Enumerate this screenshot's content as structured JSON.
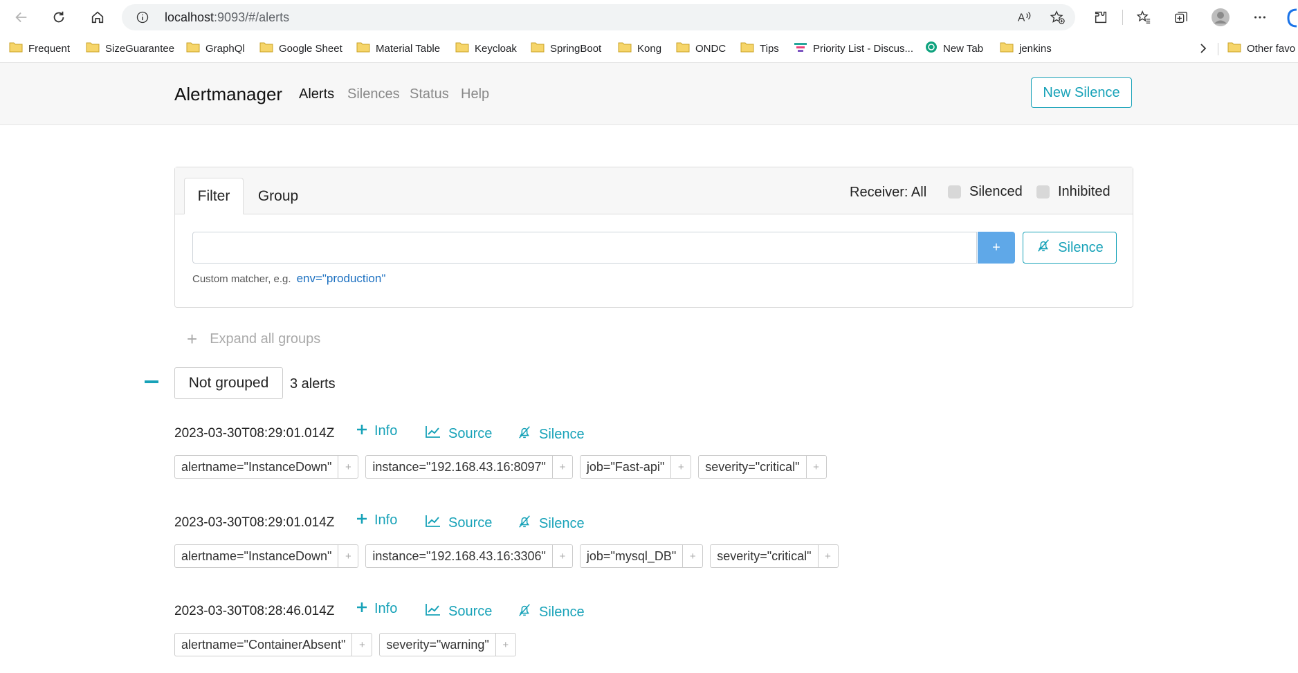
{
  "browser": {
    "url_host": "localhost",
    "url_path": ":9093/#/alerts",
    "bookmarks": [
      {
        "label": "Frequent",
        "icon": "folder-icon"
      },
      {
        "label": "SizeGuarantee",
        "icon": "folder-icon"
      },
      {
        "label": "GraphQl",
        "icon": "folder-icon"
      },
      {
        "label": "Google Sheet",
        "icon": "folder-icon"
      },
      {
        "label": "Material Table",
        "icon": "folder-icon"
      },
      {
        "label": "Keycloak",
        "icon": "folder-icon"
      },
      {
        "label": "SpringBoot",
        "icon": "folder-icon"
      },
      {
        "label": "Kong",
        "icon": "folder-icon"
      },
      {
        "label": "ONDC",
        "icon": "folder-icon"
      },
      {
        "label": "Tips",
        "icon": "folder-icon"
      },
      {
        "label": "Priority List - Discus...",
        "icon": "list-icon"
      },
      {
        "label": "New Tab",
        "icon": "openai-icon"
      },
      {
        "label": "jenkins",
        "icon": "folder-icon"
      }
    ],
    "other_favorites": "Other favo"
  },
  "navbar": {
    "brand": "Alertmanager",
    "links": [
      "Alerts",
      "Silences",
      "Status",
      "Help"
    ],
    "active": "Alerts",
    "new_silence": "New Silence"
  },
  "filter": {
    "tabs": [
      "Filter",
      "Group"
    ],
    "receiver": "Receiver: All",
    "silenced": "Silenced",
    "inhibited": "Inhibited",
    "input_value": "",
    "plus": "+",
    "silence_btn": "Silence",
    "hint": "Custom matcher, e.g.",
    "hint_example": "env=\"production\""
  },
  "groups": {
    "expand_all": "Expand all groups",
    "group_name": "Not grouped",
    "count": "3 alerts"
  },
  "actions": {
    "info": "Info",
    "source": "Source",
    "silence": "Silence"
  },
  "alerts": [
    {
      "time": "2023-03-30T08:29:01.014Z",
      "labels": [
        "alertname=\"InstanceDown\"",
        "instance=\"192.168.43.16:8097\"",
        "job=\"Fast-api\"",
        "severity=\"critical\""
      ]
    },
    {
      "time": "2023-03-30T08:29:01.014Z",
      "labels": [
        "alertname=\"InstanceDown\"",
        "instance=\"192.168.43.16:3306\"",
        "job=\"mysql_DB\"",
        "severity=\"critical\""
      ]
    },
    {
      "time": "2023-03-30T08:28:46.014Z",
      "labels": [
        "alertname=\"ContainerAbsent\"",
        "severity=\"warning\""
      ]
    }
  ],
  "colors": {
    "accent": "#17a2b8",
    "primary": "#5fa8e8",
    "link": "#1a6fc0"
  }
}
